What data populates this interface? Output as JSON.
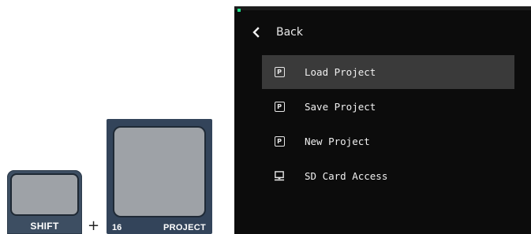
{
  "keys": {
    "shift_label": "SHIFT",
    "plus_sign": "+",
    "project_number": "16",
    "project_label": "PROJECT"
  },
  "screen": {
    "back_label": "Back",
    "accent_color": "#22e08a",
    "selected_index": 0,
    "menu": [
      {
        "label": "Load Project",
        "icon": "project-icon"
      },
      {
        "label": "Save Project",
        "icon": "project-icon"
      },
      {
        "label": "New Project",
        "icon": "project-icon"
      },
      {
        "label": "SD Card Access",
        "icon": "computer-icon"
      }
    ],
    "project_icon_glyph": "P"
  }
}
